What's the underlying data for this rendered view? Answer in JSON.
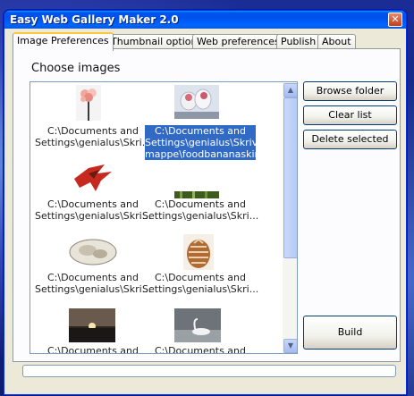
{
  "window": {
    "title": "Easy Web Gallery Maker 2.0",
    "close_glyph": "✕"
  },
  "tabs": [
    {
      "label": "Image Preferences",
      "active": true
    },
    {
      "label": "Thumbnail options",
      "active": false
    },
    {
      "label": "Web preferences",
      "active": false
    },
    {
      "label": "Publish",
      "active": false
    },
    {
      "label": "About",
      "active": false
    }
  ],
  "panel": {
    "heading": "Choose images"
  },
  "images": [
    {
      "caption": "C:\\Documents and Settings\\genialus\\Skri...",
      "icon": "flower-thumb"
    },
    {
      "caption": "C:\\Documents and Settings\\genialus\\Skrivebord\\Ny mappe\\foodbananaskin.jpg",
      "icon": "tulips-thumb",
      "selected": true
    },
    {
      "caption": "C:\\Documents and Settings\\genialus\\Skri...",
      "icon": "red-bird-thumb"
    },
    {
      "caption": "C:\\Documents and Settings\\genialus\\Skri...",
      "icon": "grass-thumb"
    },
    {
      "caption": "C:\\Documents and Settings\\genialus\\Skri...",
      "icon": "shell-thumb"
    },
    {
      "caption": "C:\\Documents and Settings\\genialus\\Skri...",
      "icon": "pinecone-thumb"
    },
    {
      "caption": "C:\\Documents and",
      "icon": "sunset-thumb"
    },
    {
      "caption": "C:\\Documents and",
      "icon": "swan-thumb"
    }
  ],
  "buttons": {
    "browse": "Browse folder",
    "clear": "Clear list",
    "delete": "Delete selected",
    "build": "Build"
  },
  "progress": {
    "value": 0
  },
  "colors": {
    "selection": "#316ac5",
    "titlebar": "#0053ee"
  }
}
